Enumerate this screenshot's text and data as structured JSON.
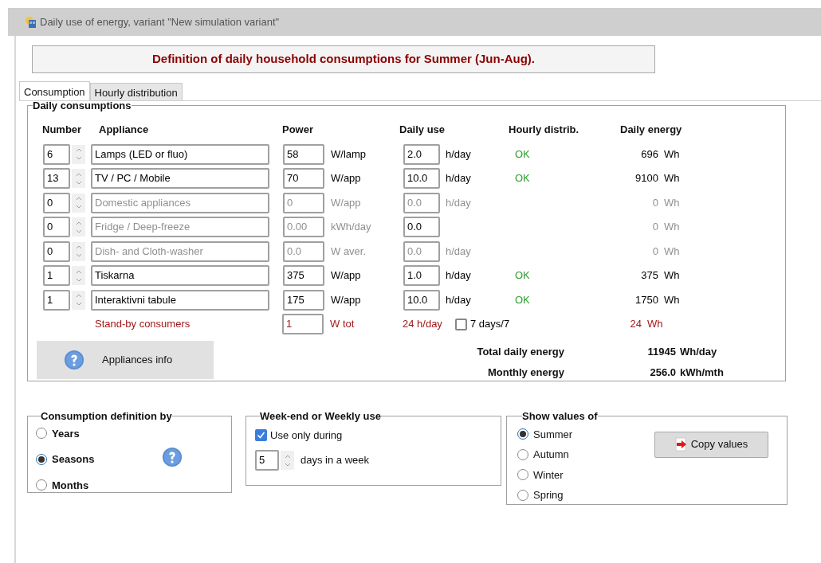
{
  "window": {
    "title": "Daily use of energy, variant \"New simulation variant\""
  },
  "header": "Definition of daily household consumptions for Summer (Jun-Aug).",
  "tabs": [
    {
      "label": "Consumption",
      "selected": true
    },
    {
      "label": "Hourly distribution",
      "selected": false
    }
  ],
  "daily_consumptions": {
    "title": "Daily consumptions",
    "columns": [
      "Number",
      "Appliance",
      "Power",
      "Daily use",
      "Hourly distrib.",
      "Daily energy"
    ],
    "rows": [
      {
        "number": "6",
        "appliance": "Lamps (LED or fluo)",
        "power": "58",
        "power_unit": "W/lamp",
        "daily_use": "2.0",
        "use_unit": "h/day",
        "hourly": "OK",
        "energy": "696",
        "energy_unit": "Wh",
        "disabled": false,
        "use_disabled": false
      },
      {
        "number": "13",
        "appliance": "TV / PC / Mobile",
        "power": "70",
        "power_unit": "W/app",
        "daily_use": "10.0",
        "use_unit": "h/day",
        "hourly": "OK",
        "energy": "9100",
        "energy_unit": "Wh",
        "disabled": false,
        "use_disabled": false
      },
      {
        "number": "0",
        "appliance": "Domestic appliances",
        "power": "0",
        "power_unit": "W/app",
        "daily_use": "0.0",
        "use_unit": "h/day",
        "energy": "0",
        "energy_unit": "Wh",
        "disabled": true,
        "use_disabled": true
      },
      {
        "number": "0",
        "appliance": "Fridge / Deep-freeze",
        "power": "0.00",
        "power_unit": "kWh/day",
        "daily_use": "0.0",
        "energy": "0",
        "energy_unit": "Wh",
        "disabled": true,
        "use_disabled": false
      },
      {
        "number": "0",
        "appliance": "Dish- and Cloth-washer",
        "power": "0.0",
        "power_unit": "W aver.",
        "daily_use": "0.0",
        "use_unit": "h/day",
        "energy": "0",
        "energy_unit": "Wh",
        "disabled": true,
        "use_disabled": true
      },
      {
        "number": "1",
        "appliance": "Tiskarna",
        "power": "375",
        "power_unit": "W/app",
        "daily_use": "1.0",
        "use_unit": "h/day",
        "hourly": "OK",
        "energy": "375",
        "energy_unit": "Wh",
        "disabled": false,
        "use_disabled": false
      },
      {
        "number": "1",
        "appliance": "Interaktivni tabule",
        "power": "175",
        "power_unit": "W/app",
        "daily_use": "10.0",
        "use_unit": "h/day",
        "hourly": "OK",
        "energy": "1750",
        "energy_unit": "Wh",
        "disabled": false,
        "use_disabled": false
      }
    ],
    "standby": {
      "label": "Stand-by consumers",
      "power": "1",
      "power_unit": "W tot",
      "hours": "24 h/day",
      "seven_days": {
        "label": "7 days/7",
        "checked": false
      },
      "energy": "24",
      "energy_unit": "Wh"
    },
    "info_button": "Appliances info",
    "totals": [
      {
        "label": "Total daily energy",
        "value": "11945",
        "unit": "Wh/day"
      },
      {
        "label": "Monthly energy",
        "value": "256.0",
        "unit": "kWh/mth"
      }
    ]
  },
  "definition_by": {
    "title": "Consumption definition by",
    "options": [
      {
        "label": "Years",
        "selected": false
      },
      {
        "label": "Seasons",
        "selected": true
      },
      {
        "label": "Months",
        "selected": false
      }
    ]
  },
  "weekly_use": {
    "title": "Week-end or Weekly use",
    "use_only": {
      "label": "Use only during",
      "checked": true
    },
    "days": "5",
    "days_label": "days in a week"
  },
  "show_values": {
    "title": "Show values of",
    "options": [
      {
        "label": "Summer",
        "selected": true
      },
      {
        "label": "Autumn",
        "selected": false
      },
      {
        "label": "Winter",
        "selected": false
      },
      {
        "label": "Spring",
        "selected": false
      }
    ],
    "copy_button": "Copy values"
  }
}
